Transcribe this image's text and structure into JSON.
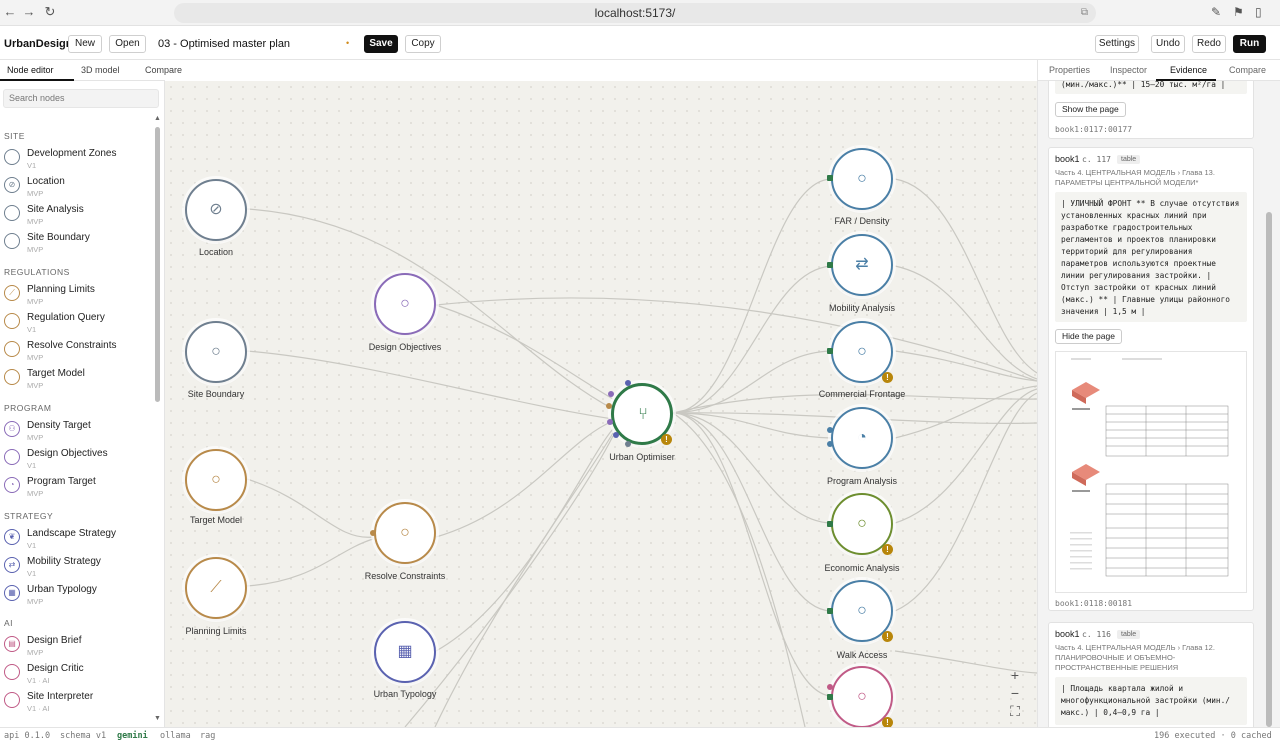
{
  "browser": {
    "url": "localhost:5173/"
  },
  "header": {
    "brand": "UrbanDesign",
    "new_label": "New",
    "open_label": "Open",
    "project_title": "03 - Optimised master plan",
    "dirty_marker": "•",
    "save_label": "Save",
    "copy_label": "Copy",
    "settings_label": "Settings",
    "undo_label": "Undo",
    "redo_label": "Redo",
    "run_label": "Run"
  },
  "left_tabs": [
    "Node editor",
    "3D model",
    "Compare"
  ],
  "palette": {
    "search_placeholder": "Search nodes",
    "categories": [
      {
        "name": "SITE",
        "items": [
          {
            "name": "Development Zones",
            "sub": "V1"
          },
          {
            "name": "Location",
            "sub": "MVP"
          },
          {
            "name": "Site Analysis",
            "sub": "MVP"
          },
          {
            "name": "Site Boundary",
            "sub": "MVP"
          }
        ]
      },
      {
        "name": "REGULATIONS",
        "items": [
          {
            "name": "Planning Limits",
            "sub": "MVP"
          },
          {
            "name": "Regulation Query",
            "sub": "V1"
          },
          {
            "name": "Resolve Constraints",
            "sub": "MVP"
          },
          {
            "name": "Target Model",
            "sub": "MVP"
          }
        ]
      },
      {
        "name": "PROGRAM",
        "items": [
          {
            "name": "Density Target",
            "sub": "MVP"
          },
          {
            "name": "Design Objectives",
            "sub": "V1"
          },
          {
            "name": "Program Target",
            "sub": "MVP"
          }
        ]
      },
      {
        "name": "STRATEGY",
        "items": [
          {
            "name": "Landscape Strategy",
            "sub": "V1"
          },
          {
            "name": "Mobility Strategy",
            "sub": "V1"
          },
          {
            "name": "Urban Typology",
            "sub": "MVP"
          }
        ]
      },
      {
        "name": "AI",
        "items": [
          {
            "name": "Design Brief",
            "sub": "MVP"
          },
          {
            "name": "Design Critic",
            "sub": "V1 · AI"
          },
          {
            "name": "Site Interpreter",
            "sub": "V1 · AI"
          }
        ]
      }
    ]
  },
  "nodes": {
    "location": "Location",
    "site_boundary": "Site Boundary",
    "target_model": "Target Model",
    "planning_limits": "Planning Limits",
    "design_objectives": "Design Objectives",
    "resolve_constraints": "Resolve Constraints",
    "urban_typology": "Urban Typology",
    "urban_optimiser": "Urban Optimiser",
    "far_density": "FAR / Density",
    "mobility_analysis": "Mobility Analysis",
    "commercial_frontage": "Commercial Frontage",
    "program_analysis": "Program Analysis",
    "economic_analysis": "Economic Analysis",
    "walk_access": "Walk Access"
  },
  "right_tabs": [
    "Properties",
    "Inspector",
    "Evidence",
    "Compare"
  ],
  "evidence": {
    "card0": {
      "snippet_tail": "(мин./макс.)** | 15–20 тыс. м²/га |",
      "button": "Show the page",
      "ref": "book1:0117:00177"
    },
    "card1": {
      "book": "book1",
      "page": "с. 117",
      "tag": "table",
      "crumb": "Часть 4. ЦЕНТРАЛЬНАЯ МОДЕЛЬ › Глава 13. ПАРАМЕТРЫ ЦЕНТРАЛЬНОЙ МОДЕЛИ*",
      "snippet": "| УЛИЧНЫЙ ФРОНТ ** В случае отсутствия установленных красных линий при разработке градостроительных регламентов и проектов планировки территорий для регулирования параметров используются проектные линии регулирования застройки. | Отступ застройки от красных линий (макс.) ** | Главные улицы районного значения | 1,5 м |",
      "button": "Hide the page",
      "ref": "book1:0118:00181"
    },
    "card2": {
      "book": "book1",
      "page": "с. 116",
      "tag": "table",
      "crumb": "Часть 4. ЦЕНТРАЛЬНАЯ МОДЕЛЬ › Глава 12. ПЛАНИРОВОЧНЫЕ И ОБЪЕМНО-ПРОСТРАНСТВЕННЫЕ РЕШЕНИЯ",
      "snippet": "| Площадь квартала жилой и многофункциональной застройки (мин./ макс.) | 0,4–0,9 га |"
    }
  },
  "status": {
    "api": "api 0.1.0",
    "schema": "schema v1",
    "gemini": "gemini",
    "ollama": "ollama",
    "rag": "rag",
    "right": "196 executed · 0 cached"
  },
  "colors": {
    "site": "#6f7f8f",
    "regulations": "#b88a4a",
    "program": "#8a6bb8",
    "typology": "#5a62b0",
    "optimiser": "#2f7a48",
    "analysis": "#4a7fa6",
    "economic": "#6d8e2f",
    "ai": "#c05a86",
    "warn": "#b8860b"
  }
}
